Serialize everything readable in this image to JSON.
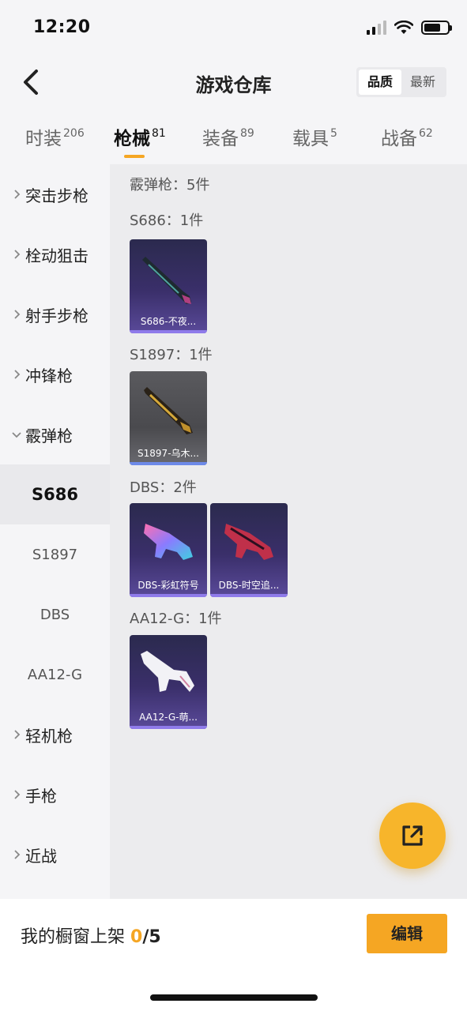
{
  "status_bar": {
    "time": "12:20"
  },
  "nav": {
    "title": "游戏仓库",
    "sort_options": [
      "品质",
      "最新"
    ]
  },
  "tabs": [
    {
      "label": "时装",
      "count": "206"
    },
    {
      "label": "枪械",
      "count": "81"
    },
    {
      "label": "装备",
      "count": "89"
    },
    {
      "label": "载具",
      "count": "5"
    },
    {
      "label": "战备",
      "count": "62"
    }
  ],
  "sidebar": {
    "categories": [
      "突击步枪",
      "栓动狙击",
      "射手步枪",
      "冲锋枪",
      "霰弹枪"
    ],
    "subitems": [
      "S686",
      "S1897",
      "DBS",
      "AA12-G"
    ],
    "categories_after": [
      "轻机枪",
      "手枪",
      "近战"
    ]
  },
  "content": {
    "group_header": "霰弹枪：5件",
    "sections": [
      {
        "label": "S686：1件",
        "items": [
          "S686-不夜..."
        ]
      },
      {
        "label": "S1897：1件",
        "items": [
          "S1897-乌木..."
        ]
      },
      {
        "label": "DBS：2件",
        "items": [
          "DBS-彩虹符号",
          "DBS-时空追..."
        ]
      },
      {
        "label": "AA12-G：1件",
        "items": [
          "AA12-G-萌..."
        ]
      }
    ]
  },
  "bottom": {
    "shelf_label": "我的橱窗上架",
    "shelf_count": "0",
    "shelf_total": "/5",
    "edit_label": "编辑"
  },
  "colors": {
    "accent": "#f5a623",
    "card_purple": "#3a2f6a",
    "card_gray": "#4a4a4e"
  }
}
